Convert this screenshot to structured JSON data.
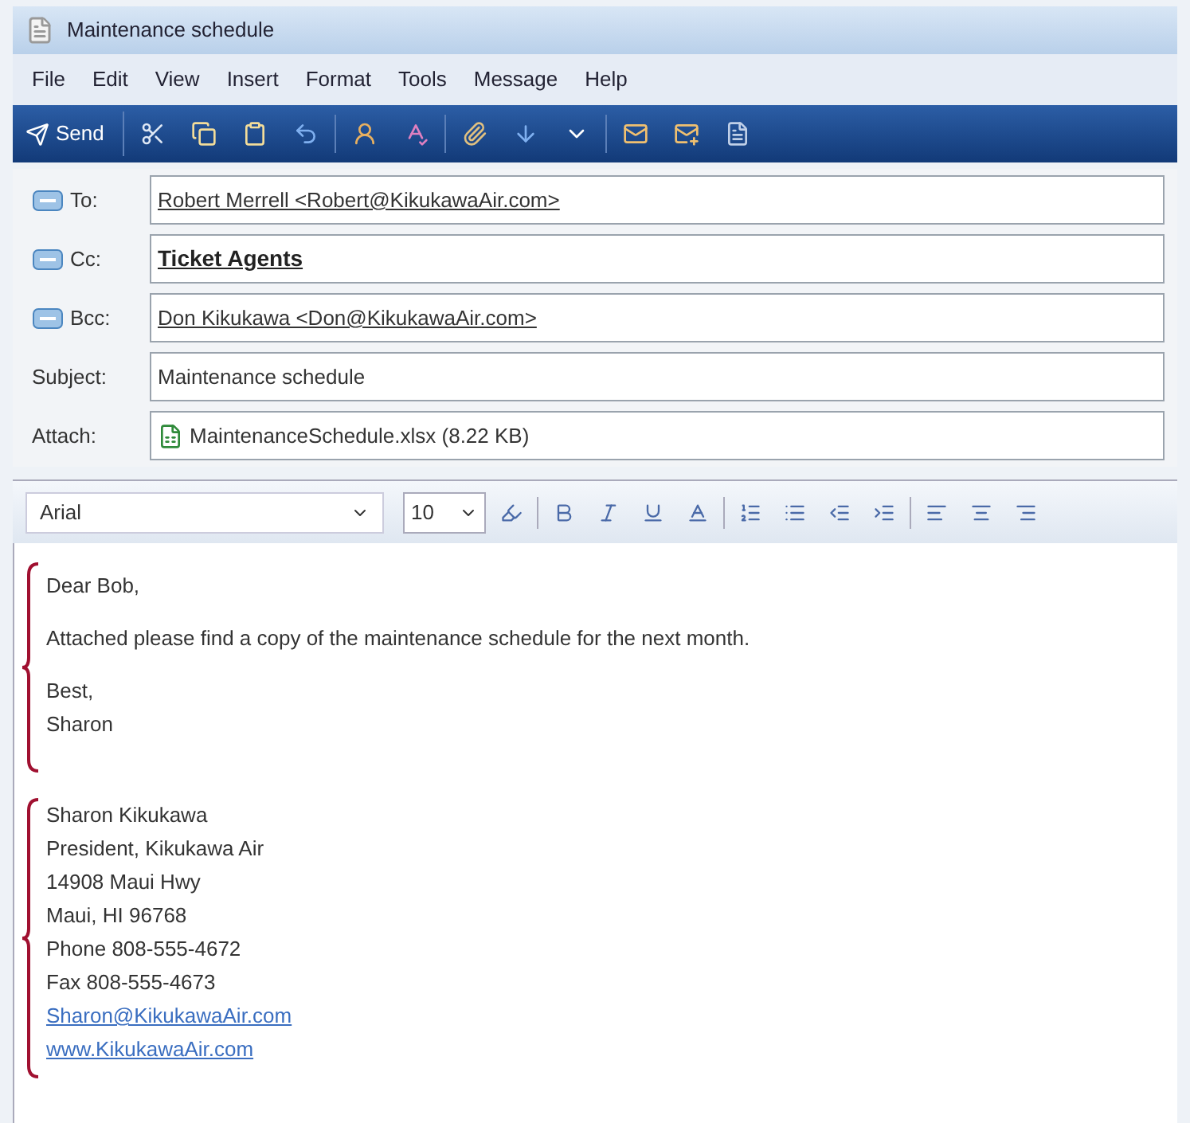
{
  "window": {
    "title": "Maintenance schedule"
  },
  "menu": [
    "File",
    "Edit",
    "View",
    "Insert",
    "Format",
    "Tools",
    "Message",
    "Help"
  ],
  "toolbar": {
    "send_label": "Send"
  },
  "fields": [
    {
      "label": "To:",
      "value": "Robert Merrell <Robert@KikukawaAir.com>",
      "kind": "address"
    },
    {
      "label": "Cc:",
      "value": "Ticket Agents",
      "kind": "group"
    },
    {
      "label": "Bcc:",
      "value": "Don Kikukawa <Don@KikukawaAir.com>",
      "kind": "address"
    },
    {
      "label": "Subject:",
      "value": "Maintenance schedule",
      "kind": "plain"
    },
    {
      "label": "Attach:",
      "value": "MaintenanceSchedule.xlsx (8.22 KB)",
      "kind": "attachment"
    }
  ],
  "format": {
    "font": "Arial",
    "size": "10"
  },
  "body": {
    "message": [
      [
        "Dear Bob,"
      ],
      [
        "Attached please find a copy of the maintenance schedule for the next month."
      ],
      [
        "Best,",
        "Sharon"
      ]
    ],
    "signature": [
      {
        "text": "Sharon Kikukawa",
        "kind": "text"
      },
      {
        "text": "President, Kikukawa Air",
        "kind": "text"
      },
      {
        "text": "14908 Maui Hwy",
        "kind": "text"
      },
      {
        "text": "Maui, HI 96768",
        "kind": "text"
      },
      {
        "text": "Phone 808-555-4672",
        "kind": "text"
      },
      {
        "text": "Fax 808-555-4673",
        "kind": "text"
      },
      {
        "text": "Sharon@KikukawaAir.com",
        "kind": "link"
      },
      {
        "text": "www.KikukawaAir.com",
        "kind": "link"
      }
    ]
  }
}
